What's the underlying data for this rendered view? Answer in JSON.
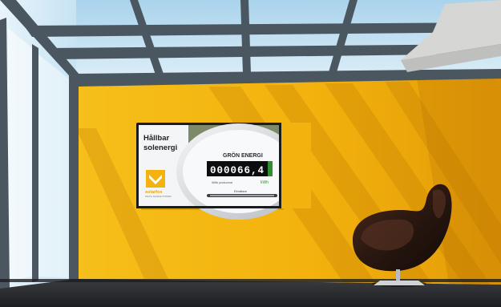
{
  "scene": {
    "description_colors": {
      "wall": "#f3b30f",
      "wall_shadow": "#d48a06",
      "sky": "#bfe0f2",
      "frame": "#4a5660",
      "floor": "#2f3134",
      "chair": "#241410"
    }
  },
  "display": {
    "heading_line1": "Hållbar",
    "heading_line2": "solenergi",
    "meter_title": "GRÖN ENERGI",
    "meter_digits": "000066,4",
    "meter_unit": "kWh",
    "meter_small_label": "Willis producerat",
    "meter_bar_label": "Elmätare",
    "brand_name": "solarfox",
    "brand_tagline": "DIGITAL SIGNAGE SYSTEMS"
  }
}
